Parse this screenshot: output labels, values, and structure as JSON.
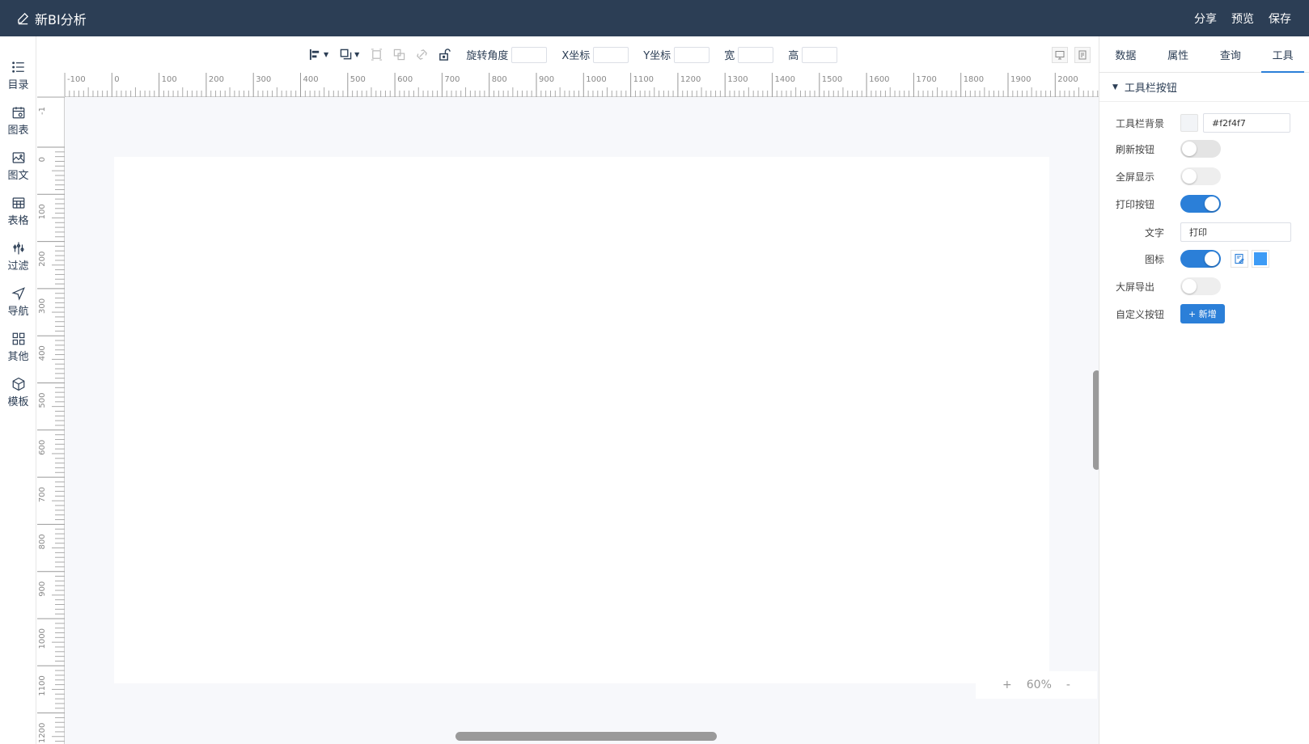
{
  "app": {
    "title": "新BI分析"
  },
  "header": {
    "actions": [
      "分享",
      "预览",
      "保存"
    ]
  },
  "sidebar": {
    "items": [
      {
        "label": "目录",
        "icon": "list-icon"
      },
      {
        "label": "图表",
        "icon": "chart-calendar-icon"
      },
      {
        "label": "图文",
        "icon": "image-text-icon"
      },
      {
        "label": "表格",
        "icon": "table-icon"
      },
      {
        "label": "过滤",
        "icon": "filter-icon"
      },
      {
        "label": "导航",
        "icon": "navigation-icon"
      },
      {
        "label": "其他",
        "icon": "grid-icon"
      },
      {
        "label": "模板",
        "icon": "cube-icon"
      }
    ]
  },
  "toolbar": {
    "rotate_label": "旋转角度",
    "x_label": "X坐标",
    "y_label": "Y坐标",
    "w_label": "宽",
    "h_label": "高"
  },
  "rulers": {
    "h_labels": [
      "-100",
      "0",
      "100",
      "200",
      "300",
      "400",
      "500",
      "600",
      "700",
      "800",
      "900",
      "1000",
      "1100",
      "1200",
      "1300",
      "1400",
      "1500",
      "1600",
      "1700",
      "1800",
      "1900",
      "2000"
    ],
    "v_labels": [
      "-1",
      "0",
      "100",
      "200",
      "300",
      "400",
      "500",
      "600",
      "700",
      "800",
      "900",
      "1000",
      "1100",
      "1200"
    ]
  },
  "zoom": {
    "plus": "+",
    "value": "60%",
    "minus": "-"
  },
  "panel": {
    "tabs": [
      "数据",
      "属性",
      "查询",
      "工具"
    ],
    "active_tab": 3,
    "section_title": "工具栏按钮",
    "toolbar_bg_label": "工具栏背景",
    "toolbar_bg_value": "#f2f4f7",
    "refresh_label": "刷新按钮",
    "refresh_on": false,
    "fullscreen_label": "全屏显示",
    "fullscreen_on": false,
    "print_label": "打印按钮",
    "print_on": true,
    "text_label": "文字",
    "text_value": "打印",
    "icon_label": "图标",
    "icon_on": true,
    "icon_color": "#3d9bf5",
    "export_label": "大屏导出",
    "export_on": false,
    "custom_label": "自定义按钮",
    "add_button": "+ 新增"
  },
  "colors": {
    "header_bg": "#2c3e55",
    "accent": "#2b7fd8",
    "canvas_bg": "#f7f8fb"
  }
}
